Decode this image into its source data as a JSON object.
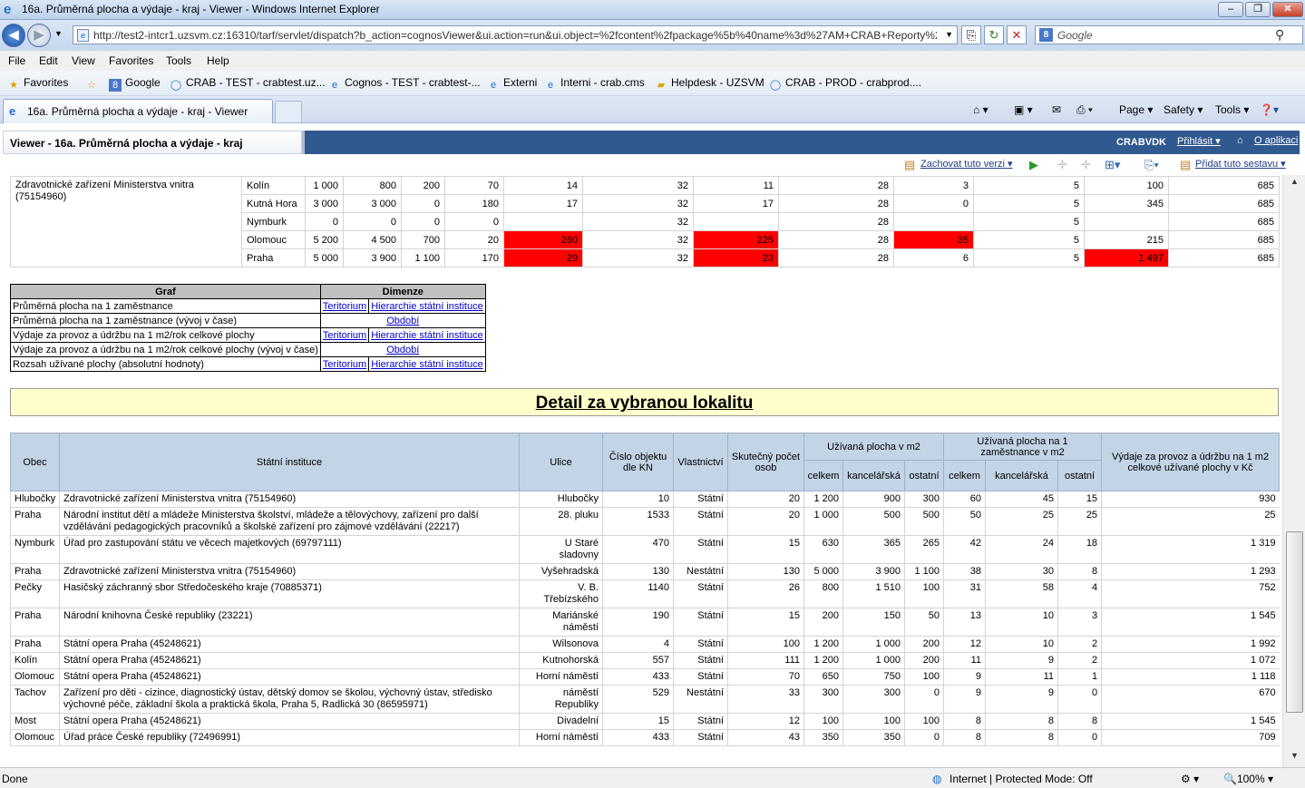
{
  "window": {
    "title": "16a. Průměrná plocha a výdaje - kraj - Viewer - Windows Internet Explorer",
    "minimize": "–",
    "maximize": "❐",
    "close": "✕"
  },
  "address": {
    "url": "http://test2-intcr1.uzsvm.cz:16310/tarf/servlet/dispatch?b_action=cognosViewer&ui.action=run&ui.object=%2fcontent%2fpackage%5b%40name%3d%27AM+CRAB+Reporty%2",
    "search_placeholder": "Google"
  },
  "menu": [
    "File",
    "Edit",
    "View",
    "Favorites",
    "Tools",
    "Help"
  ],
  "favorites": {
    "label": "Favorites",
    "items": [
      "Google",
      "CRAB - TEST - crabtest.uz...",
      "Cognos - TEST - crabtest-...",
      "Externi",
      "Interni - crab.cms",
      "Helpdesk - UZSVM",
      "CRAB - PROD - crabprod...."
    ]
  },
  "tabs": [
    {
      "label": "16a. Průměrná plocha a výdaje - kraj - Viewer"
    }
  ],
  "commandbar": {
    "page": "Page",
    "safety": "Safety",
    "tools": "Tools"
  },
  "app": {
    "title": "Viewer - 16a. Průměrná plocha a výdaje - kraj",
    "user": "CRABVDK",
    "login": "Přihlásit",
    "about": "O aplikaci"
  },
  "toolbar": {
    "keep_version": "Zachovat tuto verzi",
    "add_report": "Přidat tuto sestavu"
  },
  "top_table": {
    "institution": "Zdravotnické zařízení Ministerstva vnitra (75154960)",
    "rows": [
      {
        "city": "Kolín",
        "c1": "1 000",
        "c2": "800",
        "c3": "200",
        "c4": "70",
        "c5": "14",
        "c6": "32",
        "c7": "11",
        "c8": "28",
        "c9": "3",
        "c10": "5",
        "c11": "100",
        "c12": "685"
      },
      {
        "city": "Kutná Hora",
        "c1": "3 000",
        "c2": "3 000",
        "c3": "0",
        "c4": "180",
        "c5": "17",
        "c6": "32",
        "c7": "17",
        "c8": "28",
        "c9": "0",
        "c10": "5",
        "c11": "345",
        "c12": "685"
      },
      {
        "city": "Nymburk",
        "c1": "0",
        "c2": "0",
        "c3": "0",
        "c4": "0",
        "c5": "",
        "c6": "32",
        "c7": "",
        "c8": "28",
        "c9": "",
        "c10": "5",
        "c11": "",
        "c12": "685"
      },
      {
        "city": "Olomouc",
        "c1": "5 200",
        "c2": "4 500",
        "c3": "700",
        "c4": "20",
        "c5": "260",
        "c6": "32",
        "c7": "225",
        "c8": "28",
        "c9": "35",
        "c10": "5",
        "c11": "215",
        "c12": "685"
      },
      {
        "city": "Praha",
        "c1": "5 000",
        "c2": "3 900",
        "c3": "1 100",
        "c4": "170",
        "c5": "29",
        "c6": "32",
        "c7": "23",
        "c8": "28",
        "c9": "6",
        "c10": "5",
        "c11": "1 497",
        "c12": "685"
      }
    ]
  },
  "graf_table": {
    "headers": [
      "Graf",
      "Dimenze"
    ],
    "rows": [
      {
        "graf": "Průměrná plocha na 1 zaměstnance",
        "d1": "Teritorium",
        "d2": "Hierarchie státní instituce",
        "single": ""
      },
      {
        "graf": "Průměrná plocha na 1 zaměstnance (vývoj v čase)",
        "d1": "",
        "d2": "",
        "single": "Období"
      },
      {
        "graf": "Výdaje za provoz a údržbu na 1 m2/rok celkové plochy",
        "d1": "Teritorium",
        "d2": "Hierarchie státní instituce",
        "single": ""
      },
      {
        "graf": "Výdaje za provoz a údržbu na 1 m2/rok celkové plochy (vývoj v čase)",
        "d1": "",
        "d2": "",
        "single": "Období"
      },
      {
        "graf": "Rozsah užívané plochy (absolutní hodnoty)",
        "d1": "Teritorium",
        "d2": "Hierarchie státní instituce",
        "single": ""
      }
    ]
  },
  "detail": {
    "title": "Detail za vybranou lokalitu",
    "headers": {
      "obec": "Obec",
      "instituce": "Státní instituce",
      "ulice": "Ulice",
      "cislo": "Číslo objektu dle KN",
      "vlastnictvi": "Vlastnictví",
      "pocet": "Skutečný počet osob",
      "plocha_group": "Užívaná plocha v m2",
      "plocha_zam_group": "Užívaná plocha na 1 zaměstnance v m2",
      "celkem": "celkem",
      "kancelarska": "kancelářská",
      "ostatni": "ostatní",
      "vydaje": "Výdaje za provoz a údržbu na 1 m2 celkové užívané plochy v Kč"
    },
    "rows": [
      {
        "obec": "Hlubočky",
        "inst": "Zdravotnické zařízení Ministerstva vnitra (75154960)",
        "ulice": "Hlubočky",
        "cislo": "10",
        "vl": "Státní",
        "osob": "20",
        "p1": "1 200",
        "p2": "900",
        "p3": "300",
        "z1": "60",
        "z2": "45",
        "z3": "15",
        "vyd": "930"
      },
      {
        "obec": "Praha",
        "inst": "Národní institut dětí a mládeže Ministerstva školství, mládeže a tělovýchovy, zařízení pro další vzdělávání pedagogických pracovníků a školské zařízení pro zájmové vzdělávání (22217)",
        "ulice": "28. pluku",
        "cislo": "1533",
        "vl": "Státní",
        "osob": "20",
        "p1": "1 000",
        "p2": "500",
        "p3": "500",
        "z1": "50",
        "z2": "25",
        "z3": "25",
        "vyd": "25"
      },
      {
        "obec": "Nymburk",
        "inst": "Úřad pro zastupování státu ve věcech majetkových (69797111)",
        "ulice": "U Staré sladovny",
        "cislo": "470",
        "vl": "Státní",
        "osob": "15",
        "p1": "630",
        "p2": "365",
        "p3": "265",
        "z1": "42",
        "z2": "24",
        "z3": "18",
        "vyd": "1 319"
      },
      {
        "obec": "Praha",
        "inst": "Zdravotnické zařízení Ministerstva vnitra (75154960)",
        "ulice": "Vyšehradská",
        "cislo": "130",
        "vl": "Nestátní",
        "osob": "130",
        "p1": "5 000",
        "p2": "3 900",
        "p3": "1 100",
        "z1": "38",
        "z2": "30",
        "z3": "8",
        "vyd": "1 293"
      },
      {
        "obec": "Pečky",
        "inst": "Hasičský záchranný sbor Středočeského kraje (70885371)",
        "ulice": "V. B. Třebízského",
        "cislo": "1140",
        "vl": "Státní",
        "osob": "26",
        "p1": "800",
        "p2": "1 510",
        "p3": "100",
        "z1": "31",
        "z2": "58",
        "z3": "4",
        "vyd": "752"
      },
      {
        "obec": "Praha",
        "inst": "Národní knihovna České republiky (23221)",
        "ulice": "Mariánské náměstí",
        "cislo": "190",
        "vl": "Státní",
        "osob": "15",
        "p1": "200",
        "p2": "150",
        "p3": "50",
        "z1": "13",
        "z2": "10",
        "z3": "3",
        "vyd": "1 545"
      },
      {
        "obec": "Praha",
        "inst": "Státní opera Praha (45248621)",
        "ulice": "Wilsonova",
        "cislo": "4",
        "vl": "Státní",
        "osob": "100",
        "p1": "1 200",
        "p2": "1 000",
        "p3": "200",
        "z1": "12",
        "z2": "10",
        "z3": "2",
        "vyd": "1 992"
      },
      {
        "obec": "Kolín",
        "inst": "Státní opera Praha (45248621)",
        "ulice": "Kutnohorská",
        "cislo": "557",
        "vl": "Státní",
        "osob": "111",
        "p1": "1 200",
        "p2": "1 000",
        "p3": "200",
        "z1": "11",
        "z2": "9",
        "z3": "2",
        "vyd": "1 072"
      },
      {
        "obec": "Olomouc",
        "inst": "Státní opera Praha (45248621)",
        "ulice": "Horní náměstí",
        "cislo": "433",
        "vl": "Státní",
        "osob": "70",
        "p1": "650",
        "p2": "750",
        "p3": "100",
        "z1": "9",
        "z2": "11",
        "z3": "1",
        "vyd": "1 118"
      },
      {
        "obec": "Tachov",
        "inst": "Zařízení pro děti - cizince, diagnostický ústav, dětský domov se školou, výchovný ústav, středisko výchovné péče, základní škola a praktická škola, Praha 5, Radlická 30 (86595971)",
        "ulice": "náměstí Republiky",
        "cislo": "529",
        "vl": "Nestátní",
        "osob": "33",
        "p1": "300",
        "p2": "300",
        "p3": "0",
        "z1": "9",
        "z2": "9",
        "z3": "0",
        "vyd": "670"
      },
      {
        "obec": "Most",
        "inst": "Státní opera Praha (45248621)",
        "ulice": "Divadelní",
        "cislo": "15",
        "vl": "Státní",
        "osob": "12",
        "p1": "100",
        "p2": "100",
        "p3": "100",
        "z1": "8",
        "z2": "8",
        "z3": "8",
        "vyd": "1 545"
      },
      {
        "obec": "Olomouc",
        "inst": "Úřad práce České republiky (72496991)",
        "ulice": "Horní náměstí",
        "cislo": "433",
        "vl": "Státní",
        "osob": "43",
        "p1": "350",
        "p2": "350",
        "p3": "0",
        "z1": "8",
        "z2": "8",
        "z3": "0",
        "vyd": "709"
      }
    ]
  },
  "status": {
    "left": "Done",
    "zone": "Internet | Protected Mode: Off",
    "zoom": "100%"
  },
  "colors": {
    "highlight_red": "#ff0000",
    "header_blue": "#30598f",
    "detail_header": "#c2d4e6",
    "detail_title_bg": "#ffffcc"
  }
}
